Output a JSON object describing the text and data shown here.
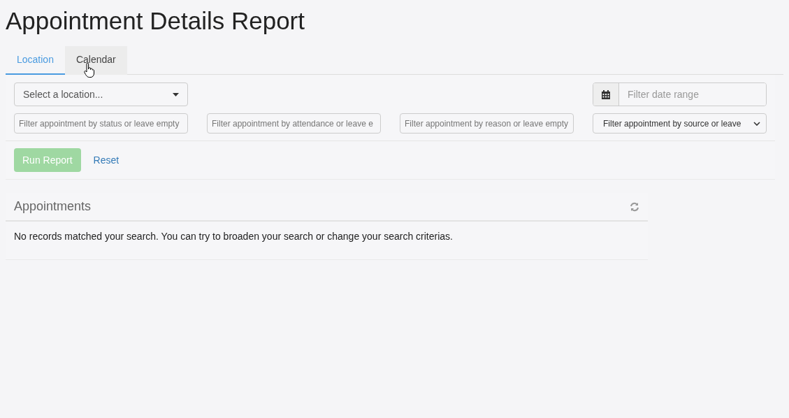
{
  "page_title": "Appointment Details Report",
  "tabs": [
    {
      "label": "Location",
      "selected": true,
      "hovered": false
    },
    {
      "label": "Calendar",
      "selected": false,
      "hovered": true
    }
  ],
  "filters": {
    "location": {
      "placeholder": "Select a location..."
    },
    "date_range": {
      "placeholder": "Filter date range"
    },
    "status": {
      "placeholder": "Filter appointment by status or leave empty"
    },
    "attendance": {
      "placeholder": "Filter appointment by attendance or leave e"
    },
    "reason": {
      "placeholder": "Filter appointment by reason or leave empty"
    },
    "source": {
      "value": "Filter appointment by source or leave"
    }
  },
  "buttons": {
    "run": {
      "label": "Run Report",
      "disabled": true
    },
    "reset": {
      "label": "Reset"
    }
  },
  "appointments": {
    "title": "Appointments",
    "message": "No records matched your search. You can try to broaden your search or change your search criterias."
  }
}
